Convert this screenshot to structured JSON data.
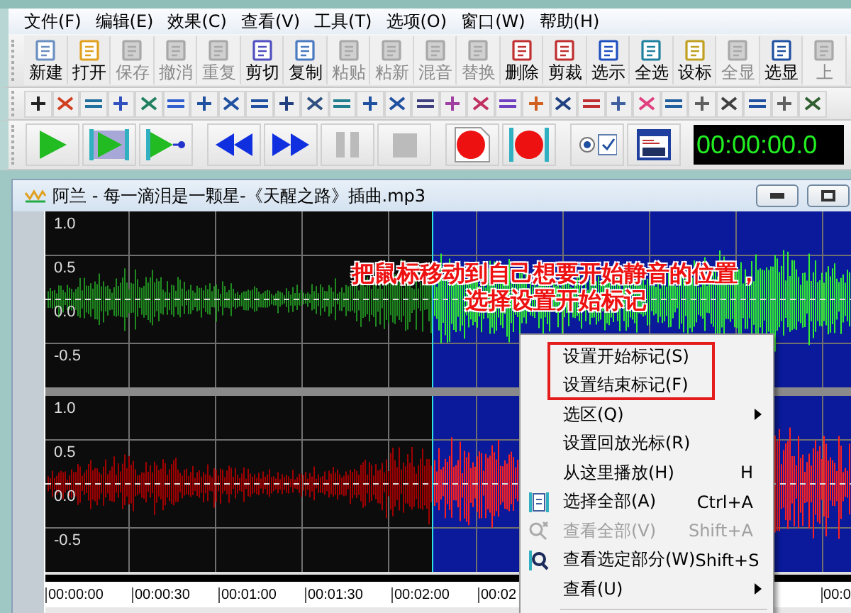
{
  "menu_bar": [
    "文件(F)",
    "编辑(E)",
    "效果(C)",
    "查看(V)",
    "工具(T)",
    "选项(O)",
    "窗口(W)",
    "帮助(H)"
  ],
  "toolbar": [
    {
      "label": "新建",
      "disabled": false
    },
    {
      "label": "打开",
      "disabled": false
    },
    {
      "label": "保存",
      "disabled": true
    },
    {
      "label": "撤消",
      "disabled": true
    },
    {
      "label": "重复",
      "disabled": true
    },
    {
      "label": "剪切",
      "disabled": false
    },
    {
      "label": "复制",
      "disabled": false
    },
    {
      "label": "粘贴",
      "disabled": true
    },
    {
      "label": "粘新",
      "disabled": true
    },
    {
      "label": "混音",
      "disabled": true
    },
    {
      "label": "替换",
      "disabled": true
    },
    {
      "label": "删除",
      "disabled": false
    },
    {
      "label": "剪裁",
      "disabled": false
    },
    {
      "label": "选示",
      "disabled": false
    },
    {
      "label": "全选",
      "disabled": false
    },
    {
      "label": "设标",
      "disabled": false
    },
    {
      "label": "全显",
      "disabled": true
    },
    {
      "label": "选显",
      "disabled": false
    },
    {
      "label": "上",
      "disabled": true
    }
  ],
  "time_display": "00:00:00.0",
  "document": {
    "title": "阿兰 - 每一滴泪是一颗星-《天醒之路》插曲.mp3",
    "tracks": [
      {
        "axis_labels": [
          "1.0",
          "0.5",
          "0.0",
          "-0.5"
        ]
      },
      {
        "axis_labels": [
          "1.0",
          "0.5",
          "0.0",
          "-0.5"
        ]
      }
    ],
    "timeline": [
      "00:00:00",
      "00:00:30",
      "00:01:00",
      "00:01:30",
      "00:02:00",
      "00:02",
      "00:0"
    ],
    "annotation": [
      "把鼠标移动到自己想要开始静音的位置，",
      "选择设置开始标记"
    ]
  },
  "context_menu": {
    "items": [
      {
        "label": "设置开始标记(S)",
        "kind": "command",
        "highlighted": true,
        "disabled": false
      },
      {
        "label": "设置结束标记(F)",
        "kind": "command",
        "highlighted": true,
        "disabled": false
      },
      {
        "label": "选区(Q)",
        "kind": "submenu",
        "highlighted": false,
        "disabled": false
      },
      {
        "label": "设置回放光标(R)",
        "kind": "command",
        "highlighted": false,
        "disabled": false
      },
      {
        "label": "从这里播放(H)",
        "kind": "command",
        "shortcut": "H",
        "highlighted": false,
        "disabled": false
      },
      {
        "label": "选择全部(A)",
        "kind": "command",
        "shortcut": "Ctrl+A",
        "highlighted": false,
        "disabled": false
      },
      {
        "label": "查看全部(V)",
        "kind": "command",
        "shortcut": "Shift+A",
        "highlighted": false,
        "disabled": true
      },
      {
        "label": "查看选定部分(W)",
        "kind": "command",
        "shortcut": "Shift+S",
        "highlighted": false,
        "disabled": false
      },
      {
        "label": "查看(U)",
        "kind": "submenu",
        "highlighted": false,
        "disabled": false
      }
    ]
  }
}
